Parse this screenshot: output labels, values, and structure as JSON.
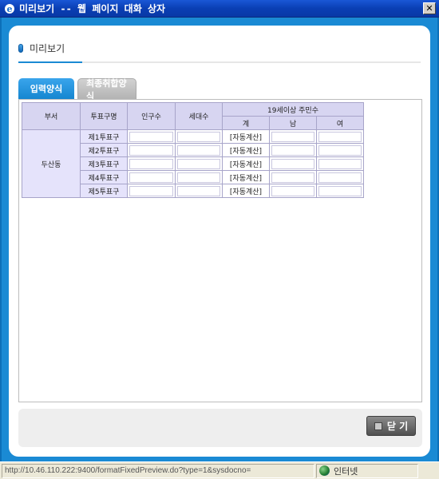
{
  "window": {
    "title": "미리보기 -- 웹 페이지 대화 상자",
    "close_glyph": "✕"
  },
  "page": {
    "header_label": "미리보기"
  },
  "tabs": [
    {
      "label": "입력양식",
      "active": true
    },
    {
      "label": "최종취합양식",
      "active": false
    }
  ],
  "table": {
    "headers": {
      "dept": "부서",
      "district": "투표구명",
      "population": "인구수",
      "households": "세대수",
      "voters_group": "19세이상 주민수",
      "total": "계",
      "male": "남",
      "female": "여"
    },
    "dept_name": "두산동",
    "rows": [
      {
        "district": "제1투표구",
        "total": "[자동계산]"
      },
      {
        "district": "제2투표구",
        "total": "[자동계산]"
      },
      {
        "district": "제3투표구",
        "total": "[자동계산]"
      },
      {
        "district": "제4투표구",
        "total": "[자동계산]"
      },
      {
        "district": "제5투표구",
        "total": "[자동계산]"
      }
    ]
  },
  "footer": {
    "close_label": "닫 기"
  },
  "statusbar": {
    "url": "http://10.46.110.222:9400/formatFixedPreview.do?type=1&sysdocno=",
    "zone": "인터넷"
  },
  "colors": {
    "frame_blue": "#1a8ad4",
    "tab_active": "#1586d0",
    "header_cell": "#d7d5f1"
  }
}
